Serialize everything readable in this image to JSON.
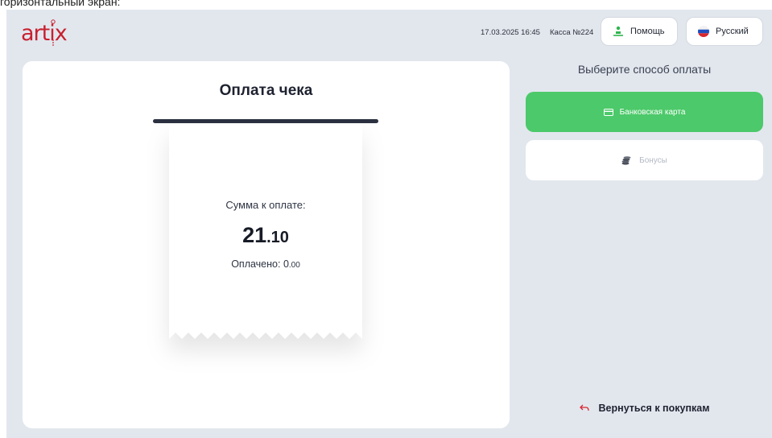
{
  "caption": "горизонтальный экран:",
  "header": {
    "logo": "artix",
    "datetime": "17.03.2025 16:45",
    "register": "Касса №224",
    "help_label": "Помощь",
    "language_label": "Русский"
  },
  "receipt": {
    "title": "Оплата чека",
    "amount_label": "Сумма к оплате:",
    "amount_int": "21",
    "amount_dec": ".10",
    "paid_label": "Оплачено: ",
    "paid_int": "0",
    "paid_dec": ".00"
  },
  "payment": {
    "title": "Выберите способ оплаты",
    "methods": [
      {
        "label": "Банковская карта",
        "icon": "credit-card-icon",
        "active": true
      },
      {
        "label": "Бонусы",
        "icon": "coins-icon",
        "active": false
      }
    ],
    "back_label": "Вернуться к покупкам"
  },
  "colors": {
    "brand": "#c8202f",
    "accent_green": "#4cc96a",
    "background": "#e2e7ee"
  }
}
